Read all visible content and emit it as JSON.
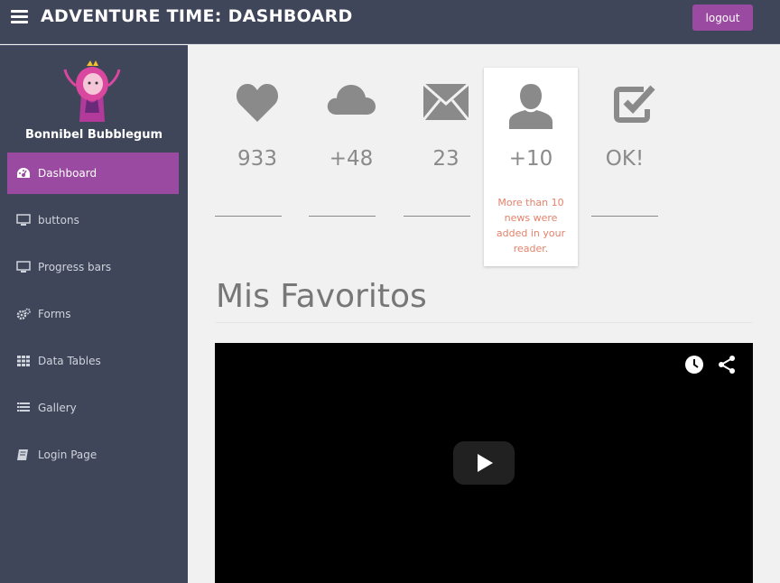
{
  "header": {
    "title": "ADVENTURE TIME: DASHBOARD",
    "logout_label": "logout"
  },
  "sidebar": {
    "user_name": "Bonnibel Bubblegum",
    "items": [
      {
        "label": "Dashboard",
        "icon": "dashboard-icon",
        "active": true
      },
      {
        "label": "buttons",
        "icon": "monitor-icon"
      },
      {
        "label": "Progress bars",
        "icon": "monitor-icon"
      },
      {
        "label": "Forms",
        "icon": "gears-icon"
      },
      {
        "label": "Data Tables",
        "icon": "grid-icon"
      },
      {
        "label": "Gallery",
        "icon": "list-icon"
      },
      {
        "label": "Login Page",
        "icon": "book-icon"
      }
    ]
  },
  "stats": [
    {
      "icon": "heart-icon",
      "value": "933"
    },
    {
      "icon": "cloud-icon",
      "value": "+48"
    },
    {
      "icon": "envelope-icon",
      "value": "23"
    },
    {
      "icon": "user-icon",
      "value": "+10",
      "note": "More than 10 news were added in your reader."
    },
    {
      "icon": "check-square-icon",
      "value": "OK!"
    }
  ],
  "section": {
    "title": "Mis Favoritos"
  },
  "colors": {
    "sidebar_bg": "#3f4659",
    "accent": "#9a4aa0",
    "note": "#e3826b",
    "icon_gray": "#8a8a8a"
  }
}
